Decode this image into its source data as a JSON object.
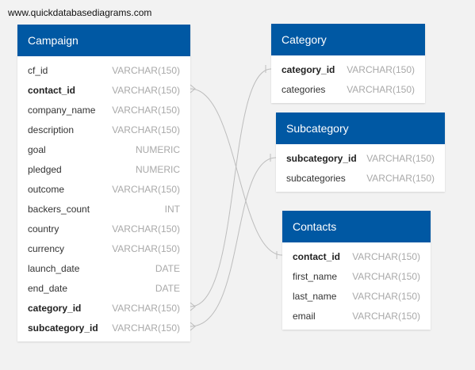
{
  "site": {
    "label": "www.quickdatabasediagrams.com"
  },
  "colors": {
    "header": "#0058a3",
    "link": "#bdbdbd"
  },
  "tables": {
    "campaign": {
      "title": "Campaign",
      "columns": [
        {
          "name": "cf_id",
          "type": "VARCHAR(150)",
          "key": false
        },
        {
          "name": "contact_id",
          "type": "VARCHAR(150)",
          "key": true
        },
        {
          "name": "company_name",
          "type": "VARCHAR(150)",
          "key": false
        },
        {
          "name": "description",
          "type": "VARCHAR(150)",
          "key": false
        },
        {
          "name": "goal",
          "type": "NUMERIC",
          "key": false
        },
        {
          "name": "pledged",
          "type": "NUMERIC",
          "key": false
        },
        {
          "name": "outcome",
          "type": "VARCHAR(150)",
          "key": false
        },
        {
          "name": "backers_count",
          "type": "INT",
          "key": false
        },
        {
          "name": "country",
          "type": "VARCHAR(150)",
          "key": false
        },
        {
          "name": "currency",
          "type": "VARCHAR(150)",
          "key": false
        },
        {
          "name": "launch_date",
          "type": "DATE",
          "key": false
        },
        {
          "name": "end_date",
          "type": "DATE",
          "key": false
        },
        {
          "name": "category_id",
          "type": "VARCHAR(150)",
          "key": true
        },
        {
          "name": "subcategory_id",
          "type": "VARCHAR(150)",
          "key": true
        }
      ]
    },
    "category": {
      "title": "Category",
      "columns": [
        {
          "name": "category_id",
          "type": "VARCHAR(150)",
          "key": true
        },
        {
          "name": "categories",
          "type": "VARCHAR(150)",
          "key": false
        }
      ]
    },
    "subcategory": {
      "title": "Subcategory",
      "columns": [
        {
          "name": "subcategory_id",
          "type": "VARCHAR(150)",
          "key": true
        },
        {
          "name": "subcategories",
          "type": "VARCHAR(150)",
          "key": false
        }
      ]
    },
    "contacts": {
      "title": "Contacts",
      "columns": [
        {
          "name": "contact_id",
          "type": "VARCHAR(150)",
          "key": true
        },
        {
          "name": "first_name",
          "type": "VARCHAR(150)",
          "key": false
        },
        {
          "name": "last_name",
          "type": "VARCHAR(150)",
          "key": false
        },
        {
          "name": "email",
          "type": "VARCHAR(150)",
          "key": false
        }
      ]
    }
  },
  "relationships": [
    {
      "from": "campaign.contact_id",
      "to": "contacts.contact_id"
    },
    {
      "from": "campaign.category_id",
      "to": "category.category_id"
    },
    {
      "from": "campaign.subcategory_id",
      "to": "subcategory.subcategory_id"
    }
  ]
}
